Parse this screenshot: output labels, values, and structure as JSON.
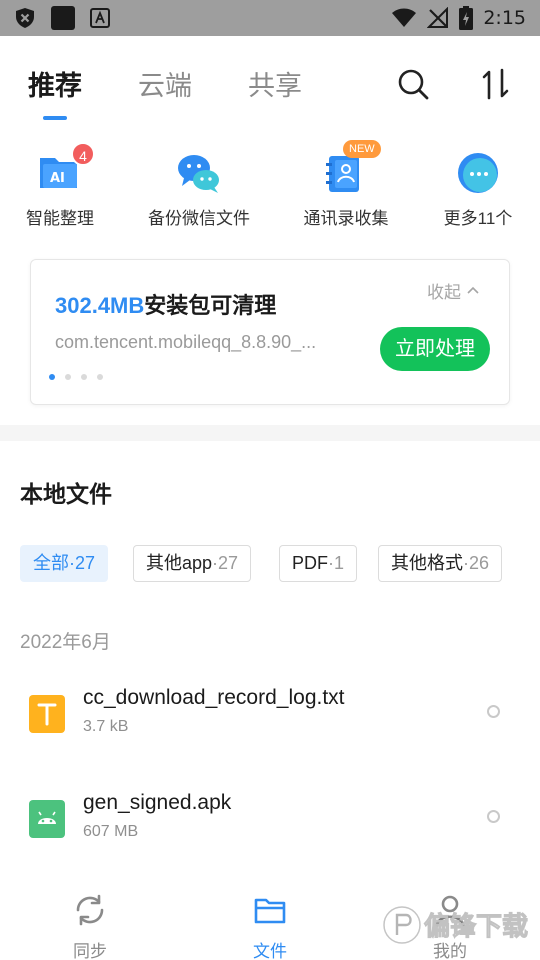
{
  "status_bar": {
    "time": "2:15"
  },
  "top_tabs": [
    {
      "label": "推荐",
      "active": true
    },
    {
      "label": "云端",
      "active": false
    },
    {
      "label": "共享",
      "active": false
    }
  ],
  "quick_actions": [
    {
      "label": "智能整理",
      "badge": "4",
      "icon": "ai-folder-icon"
    },
    {
      "label": "备份微信文件",
      "icon": "wechat-icon"
    },
    {
      "label": "通讯录收集",
      "badge": "NEW",
      "icon": "contacts-book-icon"
    },
    {
      "label": "更多11个",
      "icon": "more-dots-icon"
    }
  ],
  "cleanup_card": {
    "size": "302.4MB",
    "title_rest": "安装包可清理",
    "subtitle": "com.tencent.mobileqq_8.8.90_...",
    "collapse_label": "收起",
    "action_label": "立即处理"
  },
  "section_title": "本地文件",
  "filters": [
    {
      "label": "全部",
      "count": "·27",
      "active": true
    },
    {
      "label": "其他app",
      "count": "·27",
      "active": false
    },
    {
      "label": "PDF",
      "count": "·1",
      "active": false
    },
    {
      "label": "其他格式",
      "count": "·26",
      "active": false
    }
  ],
  "date_group": "2022年6月",
  "files": [
    {
      "name": "cc_download_record_log.txt",
      "size": "3.7 kB",
      "icon": "text-file-icon",
      "color": "#ffb21e"
    },
    {
      "name": "gen_signed.apk",
      "size": "607 MB",
      "icon": "apk-file-icon",
      "color": "#4cc27e"
    }
  ],
  "bottom_nav": [
    {
      "label": "同步",
      "icon": "sync-icon",
      "active": false
    },
    {
      "label": "文件",
      "icon": "folder-icon",
      "active": true
    },
    {
      "label": "我的",
      "icon": "profile-icon",
      "active": false
    }
  ],
  "watermark": {
    "text": "偏锋下载"
  },
  "colors": {
    "accent": "#2f8cf2",
    "action_green": "#13c25a",
    "badge_red": "#f25d5d",
    "badge_orange": "#ff9a3c"
  }
}
